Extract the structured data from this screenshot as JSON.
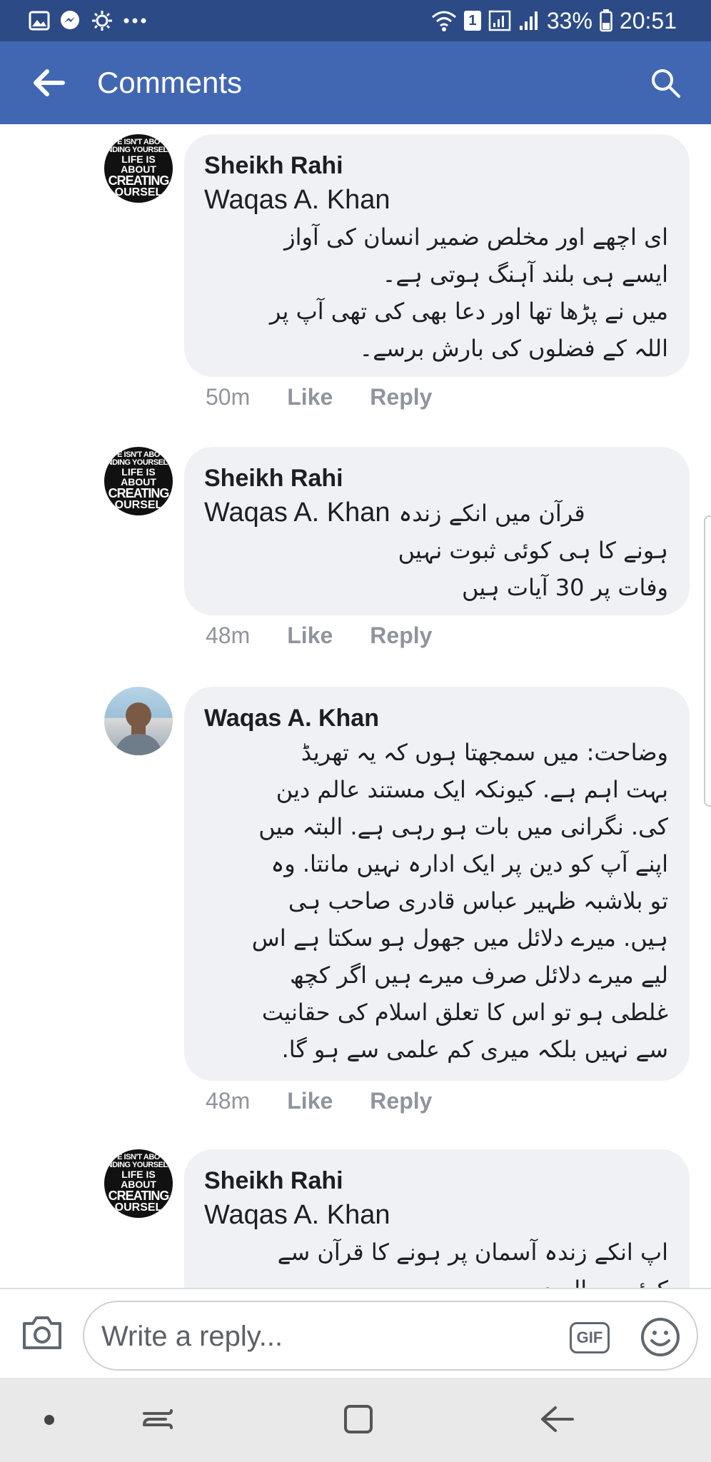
{
  "status_bar": {
    "battery": "33%",
    "time": "20:51",
    "sim_badge": "1"
  },
  "header": {
    "title": "Comments"
  },
  "comments": [
    {
      "author": "Sheikh Rahi",
      "mention": "Waqas A. Khan",
      "text": "ای اچھے اور مخلص ضمیر انسان کی آواز\nایسے ہی بلند آہنگ ہوتی ہے۔\nمیں نے پڑھا تھا اور دعا بھی کی تھی آپ پر\nاللہ کے فضلوں کی بارش برسے۔",
      "time": "50m",
      "like": "Like",
      "reply": "Reply",
      "avatar_text": [
        "E ISN'T ABO",
        "INDING YOURSELF",
        "LIFE IS ABOUT",
        "CREATING",
        "OURSEL"
      ]
    },
    {
      "author": "Sheikh Rahi",
      "mention": "Waqas A. Khan",
      "text_inline": "قرآن میں انکے زندہ",
      "text": "ہونے کا ہی کوئی ثبوت نہیں\nوفات پر 30 آیات ہیں",
      "time": "48m",
      "like": "Like",
      "reply": "Reply",
      "avatar_text": [
        "E ISN'T ABO",
        "INDING YOURSELF",
        "LIFE IS ABOUT",
        "CREATING",
        "OURSEL"
      ]
    },
    {
      "author": "Waqas A. Khan",
      "text": "وضاحت: میں سمجھتا ہوں کہ یہ تھریڈ\nبہت اہم ہے. کیونکہ ایک مستند عالم دین\nکی. نگرانی میں بات ہو رہی ہے. البتہ میں\nاپنے آپ کو دین پر ایک ادارہ نہیں مانتا. وہ\nتو بلاشبہ ظہیر عباس قادری صاحب ہی\nہیں. میرے دلائل میں جھول ہو سکتا ہے اس\nلیے میرے دلائل صرف میرے ہیں اگر کچھ\nغلطی ہو تو اس کا تعلق اسلام کی حقانیت\nسے نہیں بلکہ میری کم علمی سے ہو گا.",
      "time": "48m",
      "like": "Like",
      "reply": "Reply"
    },
    {
      "author": "Sheikh Rahi",
      "mention": "Waqas A. Khan",
      "text": "اپ انکے زندہ آسمان پر ہونے کا قرآن سے\nکوئی حوالہ دیں",
      "avatar_text": [
        "E ISN'T ABO",
        "INDING YOURSELF",
        "LIFE IS ABOUT",
        "CREATING",
        "OURSEL"
      ]
    }
  ],
  "composer": {
    "placeholder": "Write a reply...",
    "gif_label": "GIF"
  },
  "colors": {
    "status_bar": "#2c4a86",
    "app_bar": "#4267b2",
    "bubble": "#f0f1f4",
    "action_text": "#90949c"
  }
}
